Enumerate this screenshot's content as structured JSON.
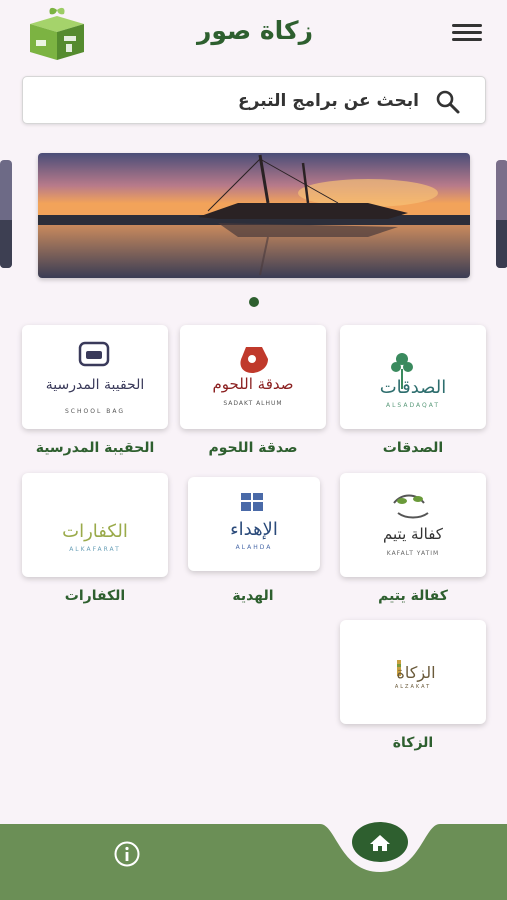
{
  "app": {
    "title": "زكاة صور"
  },
  "header": {
    "logo_icon": "zakat-sur-logo",
    "menu_icon": "hamburger-menu-icon"
  },
  "search": {
    "placeholder": "ابحث عن برامج التبرع",
    "value": "",
    "icon": "search-icon"
  },
  "carousel": {
    "slide_count": 1,
    "active_index": 0
  },
  "programs": [
    {
      "label": "الصدقات",
      "logo_text": "الصدقات",
      "logo_sub": "ALSADAQAT"
    },
    {
      "label": "صدقة اللحوم",
      "logo_text": "صدقة اللحوم",
      "logo_sub": "SADAKT ALHUM"
    },
    {
      "label": "الحقيبة المدرسية",
      "logo_text": "الحقيبة المدرسية",
      "logo_sub": "SCHOOL BAG"
    },
    {
      "label": "كفالة يتيم",
      "logo_text": "كفالة يتيم",
      "logo_sub": "KAFALT YATIM"
    },
    {
      "label": "الهدية",
      "logo_text": "الإهداء",
      "logo_sub": "ALAHDA"
    },
    {
      "label": "الكفارات",
      "logo_text": "الكفارات",
      "logo_sub": "ALKAFARAT"
    },
    {
      "label": "الزكاة",
      "logo_text": "الزكاة",
      "logo_sub": "ALZAKAT"
    }
  ],
  "bottom_nav": {
    "info_icon": "info-icon",
    "home_icon": "home-icon"
  },
  "colors": {
    "brand_green": "#2e5f2f",
    "nav_green": "#6b8f56",
    "background": "#f9f3f8"
  }
}
